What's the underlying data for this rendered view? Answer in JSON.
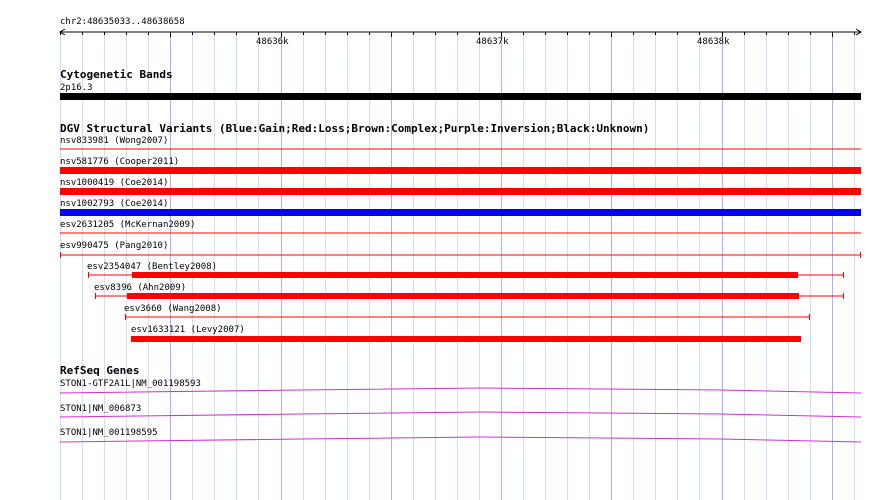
{
  "ruler": {
    "location": "chr2:48635033..48638658",
    "ticks": [
      "48636k",
      "48637k",
      "48638k"
    ]
  },
  "tracks": {
    "cytoband": {
      "title": "Cytogenetic Bands",
      "band_label": "2p16.3",
      "color": "#000000"
    },
    "dgv": {
      "title": "DGV Structural Variants (Blue:Gain;Red:Loss;Brown:Complex;Purple:Inversion;Black:Unknown)",
      "colors": {
        "gain": "#0000ff",
        "loss": "#ff0000"
      },
      "features": [
        {
          "label": "nsv833981 (Wong2007)",
          "type": "loss"
        },
        {
          "label": "nsv581776 (Cooper2011)",
          "type": "loss"
        },
        {
          "label": "nsv1000419 (Coe2014)",
          "type": "loss"
        },
        {
          "label": "nsv1002793 (Coe2014)",
          "type": "gain"
        },
        {
          "label": "esv2631205 (McKernan2009)",
          "type": "loss"
        },
        {
          "label": "esv990475 (Pang2010)",
          "type": "loss"
        },
        {
          "label": "esv2354047 (Bentley2008)",
          "type": "loss"
        },
        {
          "label": "esv8396 (Ahn2009)",
          "type": "loss"
        },
        {
          "label": "esv3660 (Wang2008)",
          "type": "loss"
        },
        {
          "label": "esv1633121 (Levy2007)",
          "type": "loss"
        }
      ]
    },
    "refseq": {
      "title": "RefSeq Genes",
      "color": "#cc33cc",
      "genes": [
        {
          "label": "STON1-GTF2A1L|NM_001198593"
        },
        {
          "label": "STON1|NM_006873"
        },
        {
          "label": "STON1|NM_001198595"
        }
      ]
    }
  }
}
